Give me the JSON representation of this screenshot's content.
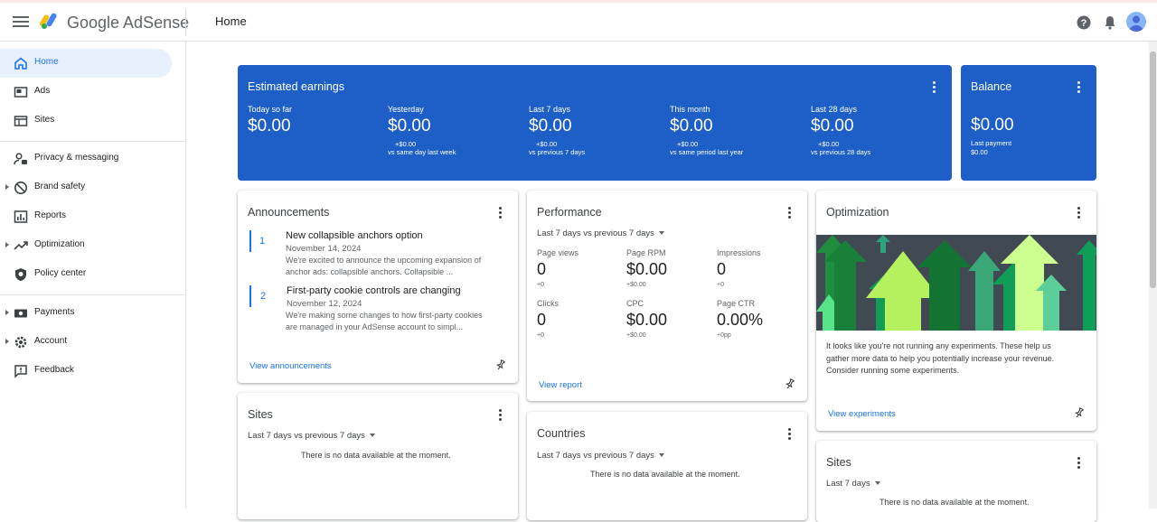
{
  "app": {
    "brand": "Google AdSense",
    "page_title": "Home"
  },
  "topbar": {
    "icons": [
      "menu-icon",
      "help-icon",
      "notifications-icon",
      "avatar"
    ]
  },
  "sidebar": {
    "items": [
      {
        "label": "Home",
        "icon": "home-icon",
        "active": true
      },
      {
        "label": "Ads",
        "icon": "ads-icon"
      },
      {
        "label": "Sites",
        "icon": "sites-icon"
      },
      {
        "label": "Privacy & messaging",
        "icon": "privacy-icon"
      },
      {
        "label": "Brand safety",
        "icon": "brand-safety-icon",
        "expandable": true
      },
      {
        "label": "Reports",
        "icon": "reports-icon"
      },
      {
        "label": "Optimization",
        "icon": "optimization-icon",
        "expandable": true
      },
      {
        "label": "Policy center",
        "icon": "policy-icon"
      },
      {
        "label": "Payments",
        "icon": "payments-icon",
        "expandable": true
      },
      {
        "label": "Account",
        "icon": "account-icon",
        "expandable": true
      },
      {
        "label": "Feedback",
        "icon": "feedback-icon"
      }
    ]
  },
  "earnings": {
    "title": "Estimated earnings",
    "cols": [
      {
        "label": "Today so far",
        "value": "$0.00",
        "delta": "",
        "cmp": ""
      },
      {
        "label": "Yesterday",
        "value": "$0.00",
        "delta": "+$0.00",
        "cmp": "vs same day last week"
      },
      {
        "label": "Last 7 days",
        "value": "$0.00",
        "delta": "+$0.00",
        "cmp": "vs previous 7 days"
      },
      {
        "label": "This month",
        "value": "$0.00",
        "delta": "+$0.00",
        "cmp": "vs same period last year"
      },
      {
        "label": "Last 28 days",
        "value": "$0.00",
        "delta": "+$0.00",
        "cmp": "vs previous 28 days"
      }
    ]
  },
  "balance": {
    "title": "Balance",
    "value": "$0.00",
    "last_payment_label": "Last payment",
    "last_payment_value": "$0.00"
  },
  "announcements": {
    "title": "Announcements",
    "items": [
      {
        "num": "1",
        "title": "New collapsible anchors option",
        "date": "November 14, 2024",
        "line1": "We're excited to announce the upcoming expansion of",
        "line2": "anchor ads: collapsible anchors. Collapsible ..."
      },
      {
        "num": "2",
        "title": "First-party cookie controls are changing",
        "date": "November 12, 2024",
        "line1": "We're making some changes to how first-party cookies",
        "line2": "are managed in your AdSense account to simpl..."
      }
    ],
    "link": "View announcements"
  },
  "performance": {
    "title": "Performance",
    "range": "Last 7 days vs previous 7 days",
    "metrics": [
      {
        "label": "Page views",
        "value": "0",
        "delta": "+0"
      },
      {
        "label": "Page RPM",
        "value": "$0.00",
        "delta": "+$0.00"
      },
      {
        "label": "Impressions",
        "value": "0",
        "delta": "+0"
      },
      {
        "label": "Clicks",
        "value": "0",
        "delta": "+0"
      },
      {
        "label": "CPC",
        "value": "$0.00",
        "delta": "+$0.00"
      },
      {
        "label": "Page CTR",
        "value": "0.00%",
        "delta": "+0pp"
      }
    ],
    "link": "View report"
  },
  "optimization": {
    "title": "Optimization",
    "line1": "It looks like you're not running any experiments. These help us",
    "line2": "gather more data to help you potentially increase your revenue.",
    "line3": "Consider running some experiments.",
    "link": "View experiments"
  },
  "sites_card": {
    "title": "Sites",
    "range": "Last 7 days vs previous 7 days",
    "nodata": "There is no data available at the moment."
  },
  "countries_card": {
    "title": "Countries",
    "range": "Last 7 days vs previous 7 days",
    "nodata": "There is no data available at the moment."
  },
  "sites_card2": {
    "title": "Sites",
    "range": "Last 7 days",
    "nodata": "There is no data available at the moment."
  },
  "colors": {
    "accent": "#1a73e8",
    "earnings_bg": "#1e5fc7",
    "active_nav_bg": "#e8f0fe"
  }
}
